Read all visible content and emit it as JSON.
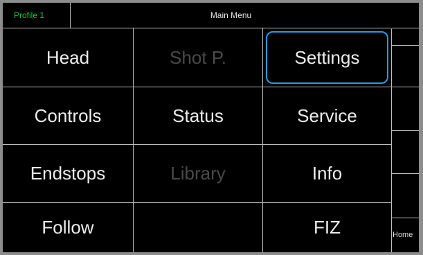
{
  "header": {
    "profile_label": "Profile 1",
    "title": "Main Menu"
  },
  "menu": {
    "items": [
      {
        "label": "Head",
        "enabled": true,
        "selected": false
      },
      {
        "label": "Shot P.",
        "enabled": false,
        "selected": false
      },
      {
        "label": "Settings",
        "enabled": true,
        "selected": true
      },
      {
        "label": "Controls",
        "enabled": true,
        "selected": false
      },
      {
        "label": "Status",
        "enabled": true,
        "selected": false
      },
      {
        "label": "Service",
        "enabled": true,
        "selected": false
      },
      {
        "label": "Endstops",
        "enabled": true,
        "selected": false
      },
      {
        "label": "Library",
        "enabled": false,
        "selected": false
      },
      {
        "label": "Info",
        "enabled": true,
        "selected": false
      },
      {
        "label": "Follow",
        "enabled": true,
        "selected": false
      },
      {
        "label": "",
        "enabled": false,
        "selected": false
      },
      {
        "label": "FIZ",
        "enabled": true,
        "selected": false
      }
    ]
  },
  "side": {
    "home_label": "Home"
  },
  "colors": {
    "background": "#000000",
    "profile_text": "#19c23f",
    "selection_border": "#1f9ee8",
    "disabled_text": "#4a4a4a",
    "grid_lines": "#bdbdbd"
  }
}
